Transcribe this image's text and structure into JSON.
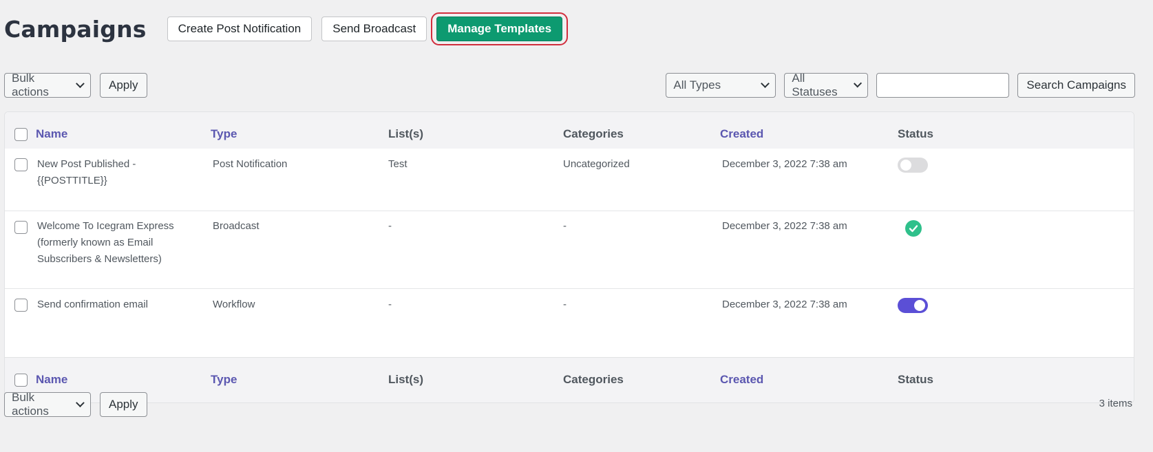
{
  "header": {
    "title": "Campaigns",
    "buttons": {
      "create_post_notification": "Create Post Notification",
      "send_broadcast": "Send Broadcast",
      "manage_templates": "Manage Templates"
    }
  },
  "toolbar": {
    "bulk_actions": "Bulk actions",
    "apply": "Apply",
    "type_filter": "All Types",
    "status_filter": "All Statuses",
    "search_value": "",
    "search_button": "Search Campaigns"
  },
  "table": {
    "columns": [
      "Name",
      "Type",
      "List(s)",
      "Categories",
      "Created",
      "Status"
    ],
    "rows": [
      {
        "name_line1": "New Post Published -",
        "name_line2": "{{POSTTITLE}}",
        "name_line3": "",
        "type": "Post Notification",
        "lists": "Test",
        "categories": "Uncategorized",
        "created": "December 3, 2022 7:38 am",
        "status": "inactive-toggle"
      },
      {
        "name_line1": "Welcome To Icegram Express",
        "name_line2": "(formerly known as Email",
        "name_line3": "Subscribers & Newsletters)",
        "type": "Broadcast",
        "lists": "-",
        "categories": "-",
        "created": "December 3, 2022 7:38 am",
        "status": "sent-check"
      },
      {
        "name_line1": "Send confirmation email",
        "name_line2": "",
        "name_line3": "",
        "type": "Workflow",
        "lists": "-",
        "categories": "-",
        "created": "December 3, 2022 7:38 am",
        "status": "active-toggle"
      }
    ]
  },
  "footer": {
    "bulk_actions": "Bulk actions",
    "apply": "Apply",
    "items_count": "3 items"
  },
  "colors": {
    "primary_button": "#0d9a70",
    "highlight_ring": "#d12e3d",
    "link_header": "#5b57b0",
    "toggle_on": "#5b4fd6",
    "check_green": "#2fc08b"
  }
}
